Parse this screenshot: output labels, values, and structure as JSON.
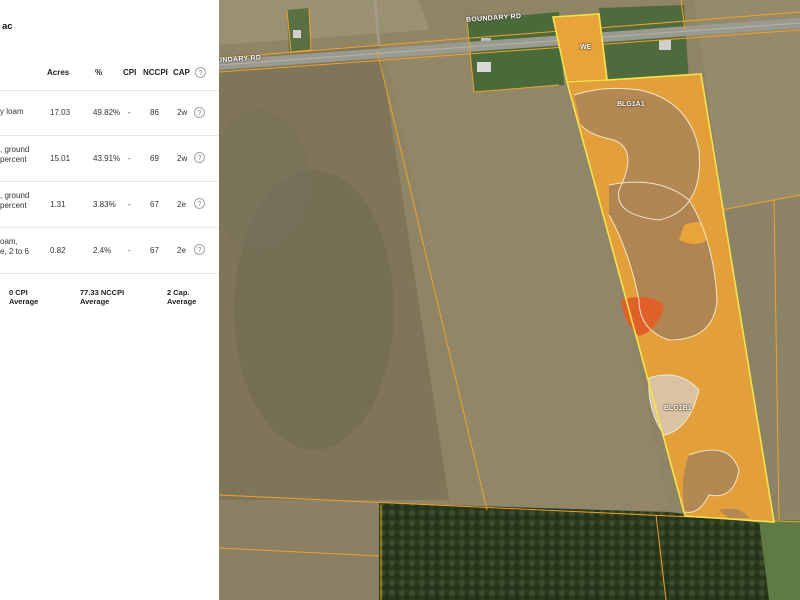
{
  "panel": {
    "title": "ac",
    "help_glyph": "?",
    "columns": {
      "acres": "Acres",
      "percent": "%",
      "cpi": "CPI",
      "nccpi": "NCCPI",
      "cap": "CAP"
    },
    "rows": [
      {
        "name_lines": [
          "y loam",
          ""
        ],
        "acres": "17.03",
        "percent": "49.82%",
        "cpi": "-",
        "nccpi": "86",
        "cap": "2w"
      },
      {
        "name_lines": [
          ", ground",
          " percent"
        ],
        "acres": "15.01",
        "percent": "43.91%",
        "cpi": "-",
        "nccpi": "69",
        "cap": "2w"
      },
      {
        "name_lines": [
          ", ground",
          " percent"
        ],
        "acres": "1.31",
        "percent": "3.83%",
        "cpi": "-",
        "nccpi": "67",
        "cap": "2e"
      },
      {
        "name_lines": [
          "oam,",
          "e, 2 to 6"
        ],
        "acres": "0.82",
        "percent": "2.4%",
        "cpi": "-",
        "nccpi": "67",
        "cap": "2e"
      }
    ],
    "summary": {
      "cpi_line1": "0 CPI",
      "cpi_line2": "Average",
      "nccpi_line1": "77.33 NCCPI",
      "nccpi_line2": "Average",
      "cap_line1": "2 Cap.",
      "cap_line2": "Average"
    }
  },
  "map": {
    "road_label_main": "BOUNDARY RD",
    "road_label_left": "UNDARY RD",
    "soil_labels": {
      "we": "WE",
      "blg1a1": "BLG1A1",
      "blg1b1": "BLG1B1"
    },
    "colors": {
      "field_boundary": "#f0a22a",
      "parcel_outline": "#f3e44b",
      "soil_orange": "#e8a33a",
      "soil_brown": "#b38852",
      "soil_light": "#d9c3a3",
      "soil_red": "#e0602a"
    }
  }
}
